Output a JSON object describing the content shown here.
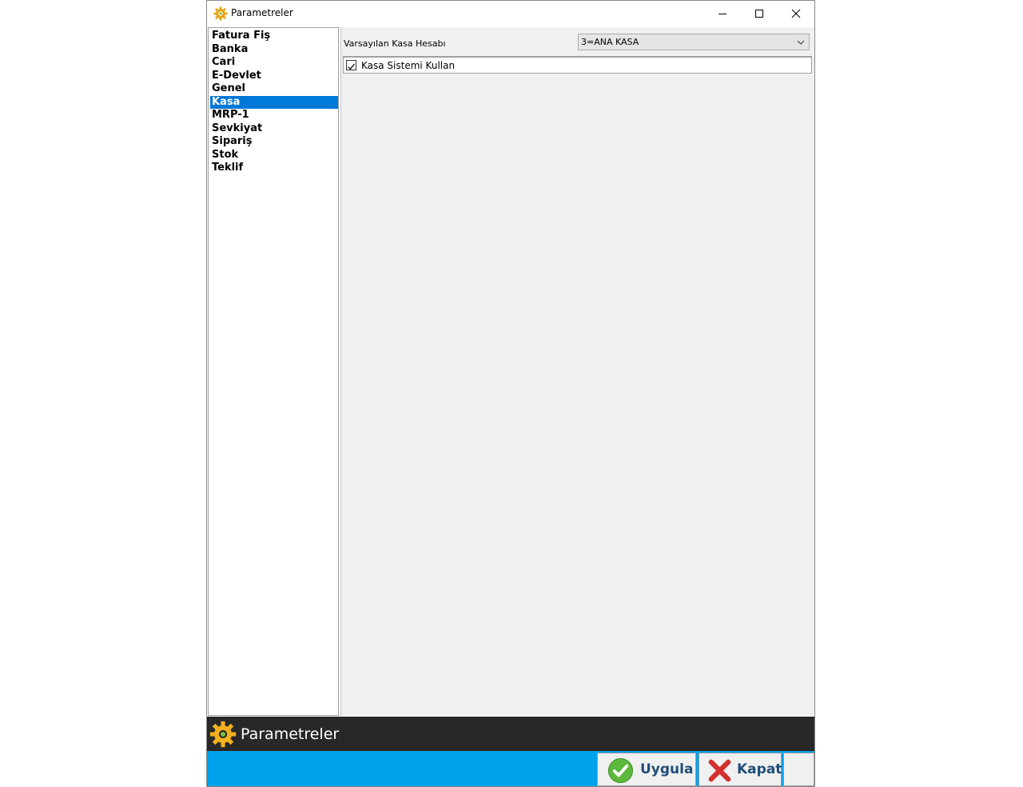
{
  "window": {
    "title": "Parametreler",
    "icon": "gear-icon"
  },
  "categories": [
    {
      "label": "Fatura Fiş",
      "selected": false
    },
    {
      "label": "Banka",
      "selected": false
    },
    {
      "label": "Cari",
      "selected": false
    },
    {
      "label": "E-Devlet",
      "selected": false
    },
    {
      "label": "Genel",
      "selected": false
    },
    {
      "label": "Kasa",
      "selected": true
    },
    {
      "label": "MRP-1",
      "selected": false
    },
    {
      "label": "Sevkiyat",
      "selected": false
    },
    {
      "label": "Sipariş",
      "selected": false
    },
    {
      "label": "Stok",
      "selected": false
    },
    {
      "label": "Teklif",
      "selected": false
    }
  ],
  "settings": {
    "default_cash_label": "Varsayılan Kasa Hesabı",
    "default_cash_value": "3=ANA KASA",
    "use_cash_system_label": "Kasa Sistemi Kullan",
    "use_cash_system_checked": true
  },
  "footer": {
    "title": "Parametreler",
    "apply_label": "Uygula",
    "close_label": "Kapat"
  },
  "colors": {
    "selection": "#0078d7",
    "dark_bar": "#282828",
    "blue_bar": "#00a2ed",
    "button_text": "#1f4e79"
  }
}
